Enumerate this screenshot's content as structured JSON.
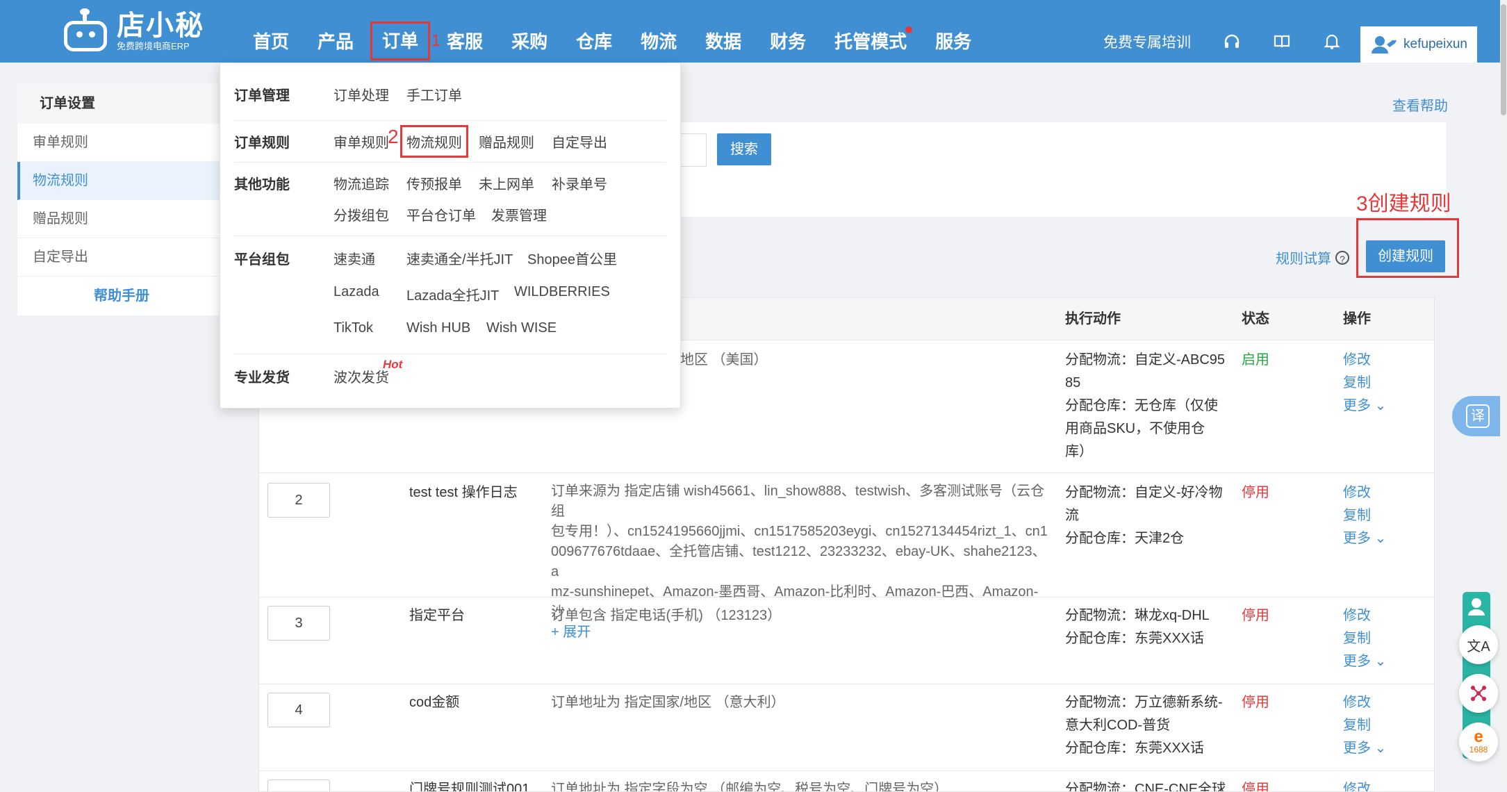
{
  "logo": {
    "name": "店小秘",
    "sub": "免费跨境电商ERP"
  },
  "nav": {
    "items": [
      "首页",
      "产品",
      "订单",
      "客服",
      "采购",
      "仓库",
      "物流",
      "数据",
      "财务",
      "托管模式",
      "服务"
    ],
    "step1": "1"
  },
  "top_right": {
    "training": "免费专属培训",
    "username": "kefupeixun"
  },
  "sidebar": {
    "title": "订单设置",
    "items": [
      "审单规则",
      "物流规则",
      "赠品规则",
      "自定导出"
    ],
    "help": "帮助手册"
  },
  "main": {
    "help_link": "查看帮助",
    "search_btn": "搜索",
    "step3": "3创建规则",
    "create_btn": "创建规则",
    "trial": "规则试算",
    "trial_icon": "?"
  },
  "table": {
    "headers": {
      "action": "执行动作",
      "status": "状态",
      "ops": "操作"
    },
    "op_labels": {
      "edit": "修改",
      "copy": "复制",
      "more": "更多"
    },
    "expand": "+ 展开",
    "rows": [
      {
        "seq": "",
        "name": "",
        "condition": [
          "地区 （美国）"
        ],
        "action": [
          "分配物流：自定义-ABC95",
          "85",
          "分配仓库：无仓库（仅使",
          "用商品SKU，不使用仓",
          "库）"
        ],
        "status": "启用"
      },
      {
        "seq": "2",
        "name": "test test 操作日志",
        "condition": [
          "订单来源为 指定店铺 wish45661、lin_show888、testwish、多客测试账号（云仓组",
          "包专用！）、cn1524195660jjmi、cn1517585203eygi、cn1527134454rizt_1、cn1",
          "009677676tdaae、全托管店铺、test1212、23233232、ebay-UK、shahe2123、a",
          "mz-sunshinepet、Amazon-墨西哥、Amazon-比利时、Amazon-巴西、Amazon-沙"
        ],
        "action": [
          "分配物流：自定义-好冷物",
          "流",
          "分配仓库：天津2仓"
        ],
        "status": "停用"
      },
      {
        "seq": "3",
        "name": "指定平台",
        "condition": [
          "订单包含 指定电话(手机) （123123）"
        ],
        "action": [
          "分配物流：琳龙xq-DHL",
          "分配仓库：东莞XXX话"
        ],
        "status": "停用"
      },
      {
        "seq": "4",
        "name": "cod金额",
        "condition": [
          "订单地址为 指定国家/地区 （意大利）"
        ],
        "action": [
          "分配物流：万立德新系统-",
          "意大利COD-普货",
          "分配仓库：东莞XXX话"
        ],
        "status": "停用"
      },
      {
        "seq": "",
        "name": "门牌号规则测试001",
        "condition": [
          "订单地址为 指定字段为空 （邮编为空、税号为空、门牌号为空）"
        ],
        "action": [
          "分配物流：CNE-CNE全球"
        ],
        "status": "停用"
      }
    ]
  },
  "dropdown": {
    "groups": [
      {
        "label": "订单管理",
        "links": [
          "订单处理",
          "手工订单"
        ]
      },
      {
        "label": "订单规则",
        "links": [
          "审单规则",
          "物流规则",
          "赠品规则",
          "自定导出"
        ]
      },
      {
        "label": "其他功能",
        "links": [
          "物流追踪",
          "传预报单",
          "未上网单",
          "补录单号",
          "分拨组包",
          "平台仓订单",
          "发票管理"
        ]
      },
      {
        "label": "平台组包",
        "links": [
          "速卖通",
          "速卖通全/半托JIT",
          "Shopee首公里",
          "Lazada",
          "Lazada全托JIT",
          "WILDBERRIES",
          "TikTok",
          "Wish HUB",
          "Wish WISE"
        ]
      },
      {
        "label": "专业发货",
        "links": [
          "波次发货"
        ]
      }
    ],
    "hot": "Hot",
    "step2": "2"
  },
  "floats": {
    "translate": "译",
    "lang": "文A",
    "brand": "1688"
  },
  "colors": {
    "primary": "#3f8fd2",
    "danger": "#e5383b",
    "success": "#27a844"
  }
}
